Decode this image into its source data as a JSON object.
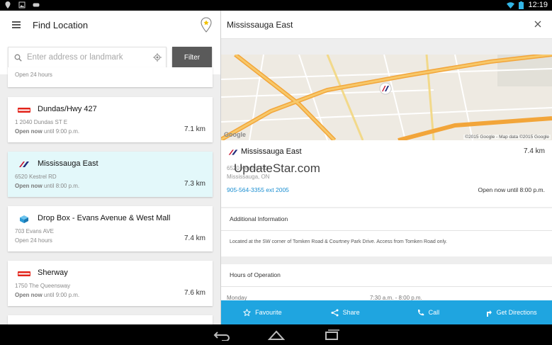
{
  "status_bar": {
    "time": "12:19",
    "icons": [
      "location-icon",
      "image-icon",
      "gamepad-icon",
      "wifi-icon",
      "battery-icon"
    ]
  },
  "left": {
    "title": "Find Location",
    "search_placeholder": "Enter address or landmark",
    "filter_label": "Filter",
    "partial_top_hours": "Open 24 hours",
    "locations": [
      {
        "name": "Dundas/Hwy 427",
        "address": "1 2040 Dundas ST E",
        "open_label": "Open now",
        "hours": " until 9:00 p.m.",
        "distance": "7.1 km",
        "brand": "esso"
      },
      {
        "name": "Mississauga East",
        "address": "6520 Kestrel RD",
        "open_label": "Open now",
        "hours": " until 8:00 p.m.",
        "distance": "7.3 km",
        "brand": "fedex-like",
        "selected": true
      },
      {
        "name": "Drop Box - Evans Avenue & West Mall",
        "address": "703 Evans AVE",
        "open_label": "",
        "hours": "Open 24 hours",
        "distance": "7.4 km",
        "brand": "dropbox"
      },
      {
        "name": "Sherway",
        "address": "1750 The Queensway",
        "open_label": "Open now",
        "hours": " until 9:00 p.m.",
        "distance": "7.6 km",
        "brand": "esso"
      }
    ]
  },
  "right": {
    "title": "Mississauga East",
    "map_copyright": "©2015 Google - Map data ©2015 Google",
    "map_logo": "Google",
    "detail": {
      "name": "Mississauga East",
      "distance": "7.4 km",
      "address": "6520 Kestrel RD",
      "city": "Mississauga, ON",
      "phone": "905-564-3355 ext 2005",
      "open_status": "Open now until 8:00 p.m."
    },
    "watermark": "UpdateStar.com",
    "additional_heading": "Additional Information",
    "additional_text": "Located at the SW corner of Tomken Road & Courtney Park Drive. Access from Tomken Road only.",
    "hours_heading": "Hours of Operation",
    "hours_day": "Monday",
    "hours_time": "7:30 a.m. - 8:00 p.m.",
    "actions": {
      "favourite": "Favourite",
      "share": "Share",
      "call": "Call",
      "directions": "Get Directions"
    }
  },
  "colors": {
    "accent": "#1fa5e0",
    "selected_card": "#e3f8fa",
    "link": "#1a8ed1"
  }
}
